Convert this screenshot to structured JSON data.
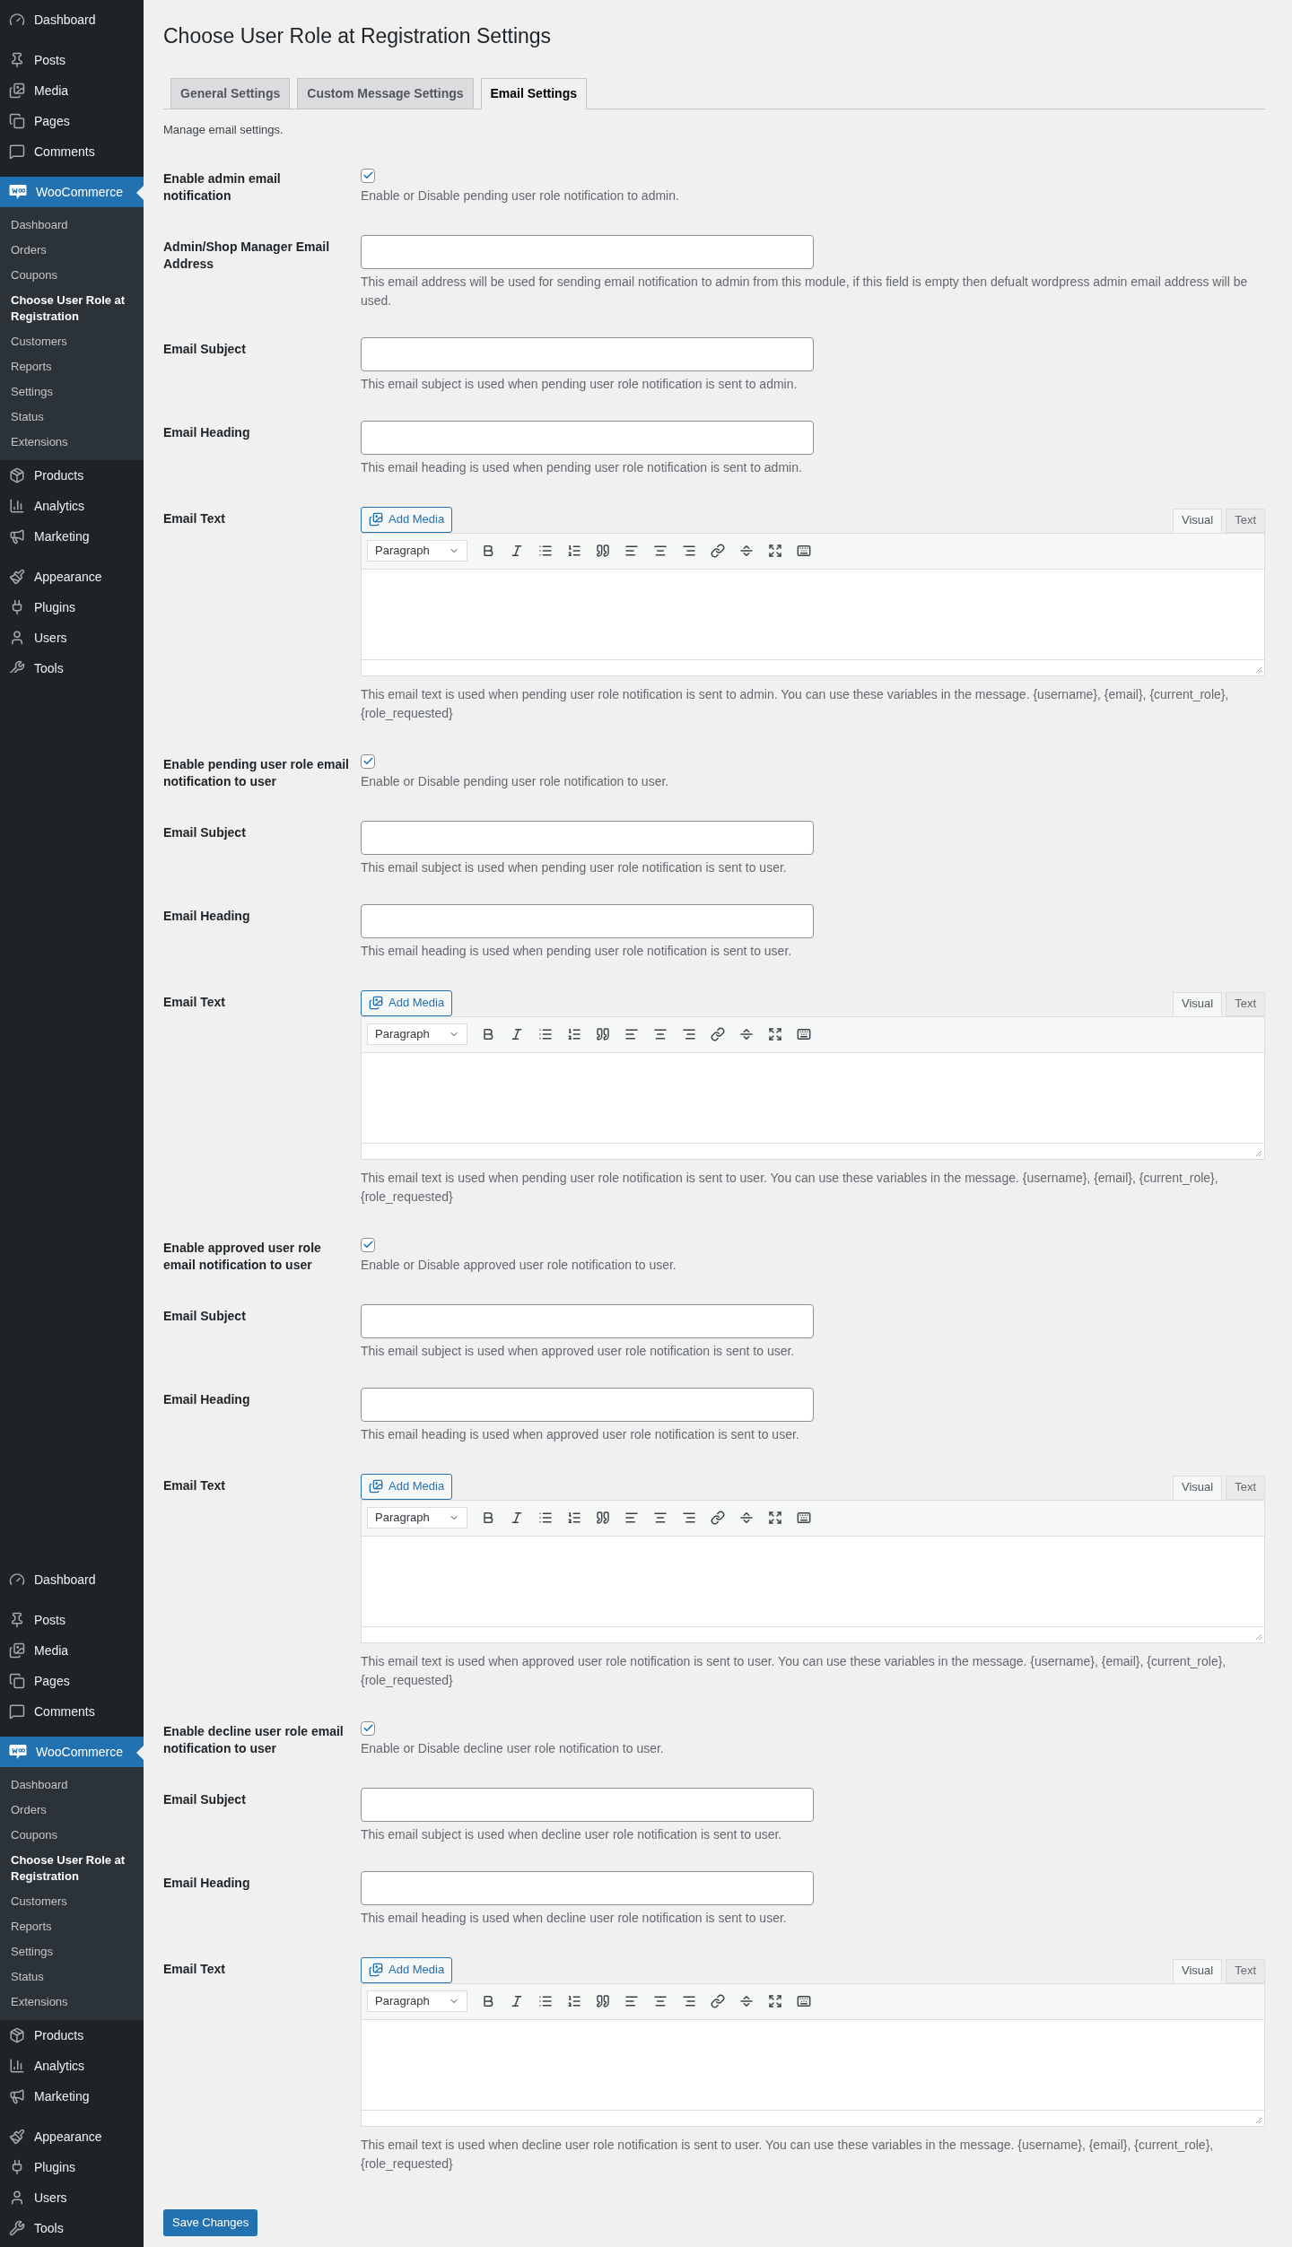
{
  "sidebar": {
    "menus": [
      {
        "groups": [
          {
            "items": [
              {
                "label": "Dashboard",
                "selected": false
              }
            ]
          },
          {
            "items": [
              {
                "label": "Posts",
                "selected": false
              },
              {
                "label": "Media",
                "selected": false
              },
              {
                "label": "Pages",
                "selected": false
              },
              {
                "label": "Comments",
                "selected": false
              }
            ]
          },
          {
            "items": [
              {
                "label": "WooCommerce",
                "selected": true,
                "children": [
                  {
                    "label": "Dashboard",
                    "selected": false
                  },
                  {
                    "label": "Orders",
                    "selected": false
                  },
                  {
                    "label": "Coupons",
                    "selected": false
                  },
                  {
                    "label": "Choose User Role at Registration",
                    "selected": true
                  },
                  {
                    "label": "Customers",
                    "selected": false
                  },
                  {
                    "label": "Reports",
                    "selected": false
                  },
                  {
                    "label": "Settings",
                    "selected": false
                  },
                  {
                    "label": "Status",
                    "selected": false
                  },
                  {
                    "label": "Extensions",
                    "selected": false
                  }
                ]
              },
              {
                "label": "Products",
                "selected": false
              },
              {
                "label": "Analytics",
                "selected": false
              },
              {
                "label": "Marketing",
                "selected": false
              }
            ]
          },
          {
            "items": [
              {
                "label": "Appearance",
                "selected": false
              },
              {
                "label": "Plugins",
                "selected": false
              },
              {
                "label": "Users",
                "selected": false
              },
              {
                "label": "Tools",
                "selected": false
              }
            ]
          }
        ]
      },
      {
        "groups": [
          {
            "items": [
              {
                "label": "Dashboard",
                "selected": false
              }
            ]
          },
          {
            "items": [
              {
                "label": "Posts",
                "selected": false
              },
              {
                "label": "Media",
                "selected": false
              },
              {
                "label": "Pages",
                "selected": false
              },
              {
                "label": "Comments",
                "selected": false
              }
            ]
          },
          {
            "items": [
              {
                "label": "WooCommerce",
                "selected": true,
                "children": [
                  {
                    "label": "Dashboard",
                    "selected": false
                  },
                  {
                    "label": "Orders",
                    "selected": false
                  },
                  {
                    "label": "Coupons",
                    "selected": false
                  },
                  {
                    "label": "Choose User Role at Registration",
                    "selected": true
                  },
                  {
                    "label": "Customers",
                    "selected": false
                  },
                  {
                    "label": "Reports",
                    "selected": false
                  },
                  {
                    "label": "Settings",
                    "selected": false
                  },
                  {
                    "label": "Status",
                    "selected": false
                  },
                  {
                    "label": "Extensions",
                    "selected": false
                  }
                ]
              },
              {
                "label": "Products",
                "selected": false
              },
              {
                "label": "Analytics",
                "selected": false
              },
              {
                "label": "Marketing",
                "selected": false
              }
            ]
          },
          {
            "items": [
              {
                "label": "Appearance",
                "selected": false
              },
              {
                "label": "Plugins",
                "selected": false
              },
              {
                "label": "Users",
                "selected": false
              },
              {
                "label": "Tools",
                "selected": false
              }
            ]
          }
        ]
      }
    ]
  },
  "page": {
    "title": "Choose User Role at Registration Settings",
    "tabs": [
      {
        "label": "General Settings",
        "selected": false
      },
      {
        "label": "Custom Message Settings",
        "selected": false
      },
      {
        "label": "Email Settings",
        "selected": true
      }
    ],
    "intro": "Manage email settings."
  },
  "fields": [
    {
      "kind": "checkbox",
      "label": "Enable admin email notification",
      "checked": true,
      "description": "Enable or Disable pending user role notification to admin."
    },
    {
      "kind": "text",
      "label": "Admin/Shop Manager Email Address",
      "description": "This email address will be used for sending email notification to admin from this module, if this field is empty then defualt wordpress admin email address will be used."
    },
    {
      "kind": "text",
      "label": "Email Subject",
      "description": "This email subject is used when pending user role notification is sent to admin."
    },
    {
      "kind": "text",
      "label": "Email Heading",
      "description": "This email heading is used when pending user role notification is sent to admin."
    },
    {
      "kind": "editor",
      "label": "Email Text",
      "add_media": "Add Media",
      "format": "Paragraph",
      "modes": [
        {
          "label": "Visual",
          "selected": true
        },
        {
          "label": "Text",
          "selected": false
        }
      ],
      "description": "This email text is used when pending user role notification is sent to admin. You can use these variables in the message. {username}, {email}, {current_role}, {role_requested}"
    },
    {
      "kind": "checkbox",
      "label": "Enable pending user role email notification to user",
      "checked": true,
      "description": "Enable or Disable pending user role notification to user."
    },
    {
      "kind": "text",
      "label": "Email Subject",
      "description": "This email subject is used when pending user role notification is sent to user."
    },
    {
      "kind": "text",
      "label": "Email Heading",
      "description": "This email heading is used when pending user role notification is sent to user."
    },
    {
      "kind": "editor",
      "label": "Email Text",
      "add_media": "Add Media",
      "format": "Paragraph",
      "modes": [
        {
          "label": "Visual",
          "selected": true
        },
        {
          "label": "Text",
          "selected": false
        }
      ],
      "description": "This email text is used when pending user role notification is sent to user. You can use these variables in the message. {username}, {email}, {current_role}, {role_requested}"
    },
    {
      "kind": "checkbox",
      "label": "Enable approved user role email notification to user",
      "checked": true,
      "description": "Enable or Disable approved user role notification to user."
    },
    {
      "kind": "text",
      "label": "Email Subject",
      "description": "This email subject is used when approved user role notification is sent to user."
    },
    {
      "kind": "text",
      "label": "Email Heading",
      "description": "This email heading is used when approved user role notification is sent to user."
    },
    {
      "kind": "editor",
      "label": "Email Text",
      "add_media": "Add Media",
      "format": "Paragraph",
      "modes": [
        {
          "label": "Visual",
          "selected": true
        },
        {
          "label": "Text",
          "selected": false
        }
      ],
      "description": "This email text is used when approved user role notification is sent to user. You can use these variables in the message. {username}, {email}, {current_role}, {role_requested}"
    },
    {
      "kind": "checkbox",
      "label": "Enable decline user role email notification to user",
      "checked": true,
      "description": "Enable or Disable decline user role notification to user."
    },
    {
      "kind": "text",
      "label": "Email Subject",
      "description": "This email subject is used when decline user role notification is sent to user."
    },
    {
      "kind": "text",
      "label": "Email Heading",
      "description": "This email heading is used when decline user role notification is sent to user."
    },
    {
      "kind": "editor",
      "label": "Email Text",
      "add_media": "Add Media",
      "format": "Paragraph",
      "modes": [
        {
          "label": "Visual",
          "selected": true
        },
        {
          "label": "Text",
          "selected": false
        }
      ],
      "description": "This email text is used when decline user role notification is sent to user. You can use these variables in the message. {username}, {email}, {current_role}, {role_requested}"
    }
  ],
  "save_button": "Save Changes"
}
